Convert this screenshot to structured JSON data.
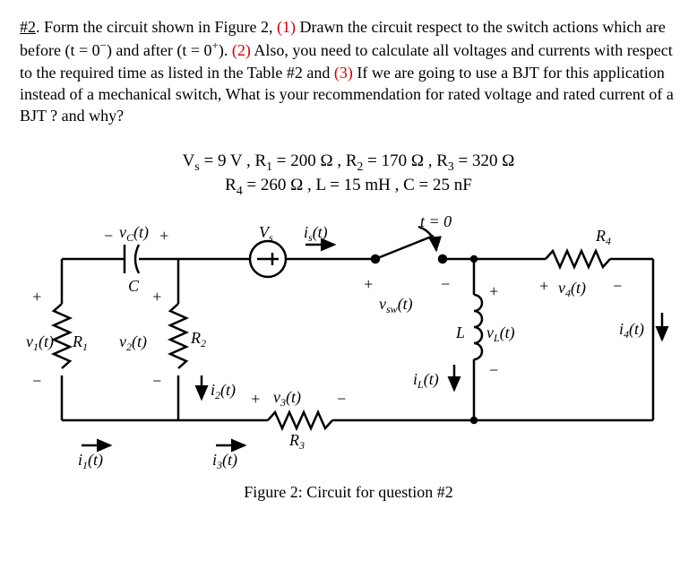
{
  "problem": {
    "num_label": "#2",
    "intro": ". Form the circuit shown in Figure 2, ",
    "p1_lbl": "(1)",
    "p1": " Drawn the circuit respect to the switch actions which are before (t = 0",
    "p1_after_minus": ") and after (t = 0",
    "p1_tail": "). ",
    "p2_lbl": "(2)",
    "p2": " Also, you need to calculate all voltages and currents with respect to the required time as listed in the Table #2  and ",
    "p3_lbl": "(3)",
    "p3": " If we are going to use a BJT for this application instead of a mechanical switch, What is your recommendation for rated voltage and rated current of a BJT ? and why?"
  },
  "params": {
    "line1": "V<sub>s</sub> = 9 V , R<sub>1</sub> = 200 Ω , R<sub>2</sub> = 170 Ω , R<sub>3</sub> = 320 Ω",
    "line2": "R<sub>4</sub> = 260 Ω , L = 15 mH , C = 25 nF"
  },
  "figure": {
    "caption": "Figure 2:  Circuit for question #2",
    "labels": {
      "vc": "v_C(t)",
      "v1": "v_1(t)",
      "v2": "v_2(t)",
      "v3": "v_3(t)",
      "v4": "v_4(t)",
      "vL": "v_L(t)",
      "vsw": "v_sw(t)",
      "Vs": "V_s",
      "is": "i_s(t)",
      "i1": "i_1(t)",
      "i2": "i_2(t)",
      "i3": "i_3(t)",
      "i4": "i_4(t)",
      "iL": "i_L(t)",
      "R1": "R_1",
      "R2": "R_2",
      "R3": "R_3",
      "R4": "R_4",
      "C": "C",
      "L": "L",
      "t0": "t = 0"
    }
  },
  "chart_data": {
    "type": "circuit-diagram",
    "source": {
      "name": "V_s",
      "value": 9,
      "unit": "V",
      "type": "dc-voltage"
    },
    "components": [
      {
        "name": "R_1",
        "value": 200,
        "unit": "Ω",
        "type": "resistor"
      },
      {
        "name": "R_2",
        "value": 170,
        "unit": "Ω",
        "type": "resistor"
      },
      {
        "name": "R_3",
        "value": 320,
        "unit": "Ω",
        "type": "resistor"
      },
      {
        "name": "R_4",
        "value": 260,
        "unit": "Ω",
        "type": "resistor"
      },
      {
        "name": "L",
        "value": 15,
        "unit": "mH",
        "type": "inductor"
      },
      {
        "name": "C",
        "value": 25,
        "unit": "nF",
        "type": "capacitor"
      },
      {
        "name": "SW",
        "type": "switch",
        "opens_at": "t = 0"
      }
    ],
    "voltages": [
      "v_C(t)",
      "v_1(t)",
      "v_2(t)",
      "v_3(t)",
      "v_4(t)",
      "v_L(t)",
      "v_sw(t)"
    ],
    "currents": [
      "i_s(t)",
      "i_1(t)",
      "i_2(t)",
      "i_3(t)",
      "i_4(t)",
      "i_L(t)"
    ]
  }
}
